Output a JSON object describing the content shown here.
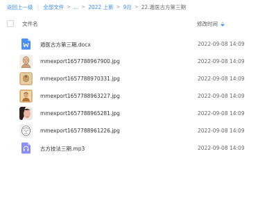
{
  "breadcrumb": {
    "back": "返回上一级",
    "all_files": "全部文件",
    "ellipsis": "...",
    "sep": ">",
    "year": "2022 上新",
    "month": "9月",
    "current": "22.遁医古方第三期"
  },
  "header": {
    "name_col": "文件名",
    "time_col": "修改时间"
  },
  "files": [
    {
      "name": "遁医古方第三期.docx",
      "time": "2022-09-08 14:09",
      "icon": "word-doc-icon"
    },
    {
      "name": "mmexport1657788967900.jpg",
      "time": "2022-09-08 14:09",
      "icon": "image-thumbnail"
    },
    {
      "name": "mmexport1657788970331.jpg",
      "time": "2022-09-08 14:09",
      "icon": "image-thumbnail"
    },
    {
      "name": "mmexport1657788963227.jpg",
      "time": "2022-09-08 14:09",
      "icon": "image-thumbnail"
    },
    {
      "name": "mmexport1657788965281.jpg",
      "time": "2022-09-08 14:09",
      "icon": "image-thumbnail"
    },
    {
      "name": "mmexport1657788961226.jpg",
      "time": "2022-09-08 14:09",
      "icon": "image-thumbnail"
    },
    {
      "name": "古方技法三期.mp3",
      "time": "2022-09-08 14:09",
      "icon": "audio-file-icon"
    }
  ],
  "colors": {
    "link": "#3b8cff",
    "doc_icon": "#4a8df8",
    "audio_icon": "#8c8cf5"
  }
}
